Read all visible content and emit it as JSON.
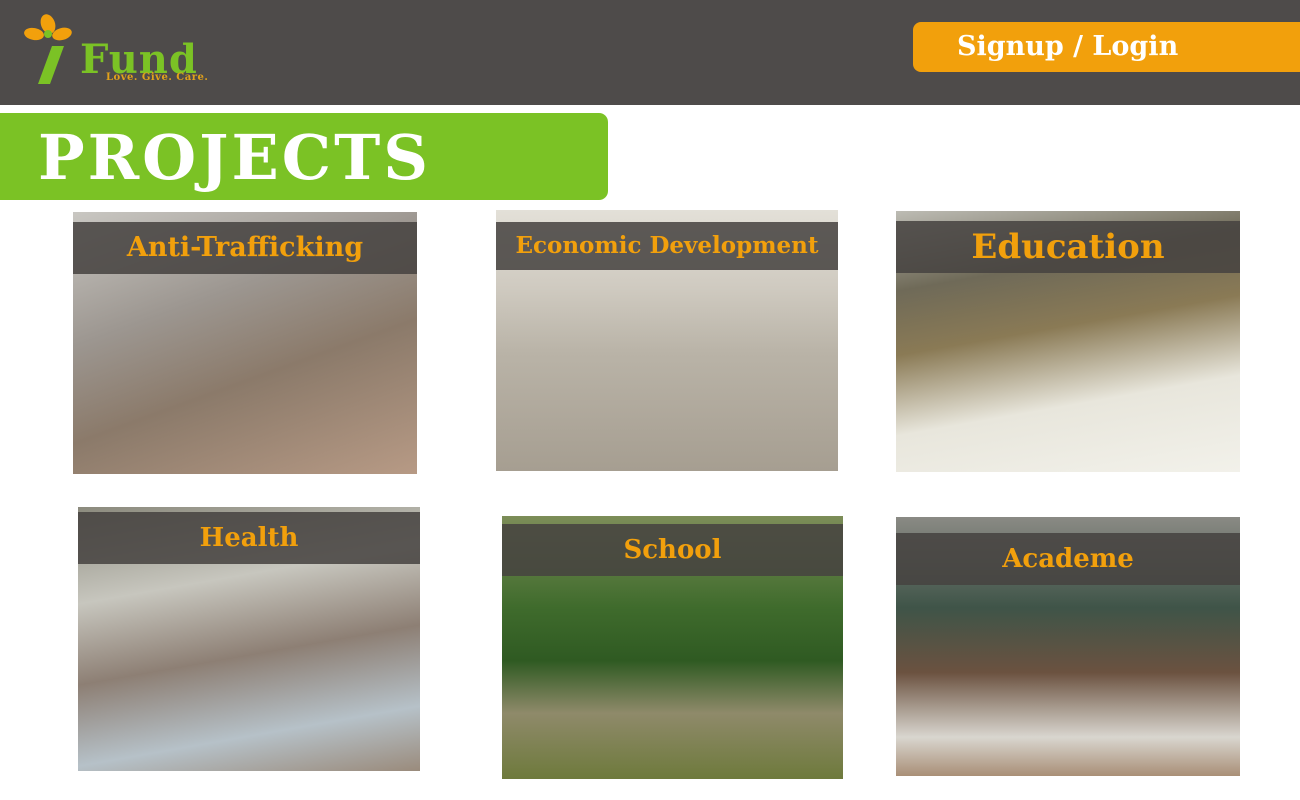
{
  "header": {
    "logo": {
      "word": "Fund",
      "tagline": "Love. Give. Care."
    },
    "login_label": "Signup / Login"
  },
  "section": {
    "title": "PROJECTS"
  },
  "projects": [
    {
      "label": "Anti-Trafficking"
    },
    {
      "label": "Economic Development"
    },
    {
      "label": "Education"
    },
    {
      "label": "Health"
    },
    {
      "label": "School"
    },
    {
      "label": "Academe"
    }
  ],
  "colors": {
    "header_bg": "#4e4b4a",
    "accent_orange": "#f2a00c",
    "accent_green": "#7bc225",
    "label_bar": "#464240"
  }
}
